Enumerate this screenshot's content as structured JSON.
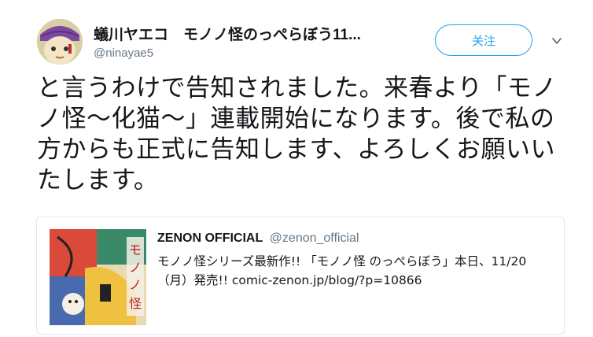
{
  "author": {
    "display_name": "蟻川ヤエコ　モノノ怪のっぺらぼう11...",
    "handle": "@ninayae5"
  },
  "follow_label": "关注",
  "tweet": {
    "text": "と言うわけで告知されました。来春より「モノノ怪〜化猫〜」連載開始になります。後で私の方からも正式に告知します、よろしくお願いいたします。"
  },
  "quote": {
    "author": "ZENON OFFICIAL",
    "handle": "@zenon_official",
    "text": "モノノ怪シリーズ最新作!! 「モノノ怪 のっぺらぼう」本日、11/20（月）発売!! comic-zenon.jp/blog/?p=10866",
    "image_title": "モノノ怪"
  },
  "colors": {
    "accent": "#1da1f2",
    "secondary_text": "#657786",
    "border": "#e1e8ed"
  },
  "icons": {
    "caret": "chevron-down-icon"
  }
}
